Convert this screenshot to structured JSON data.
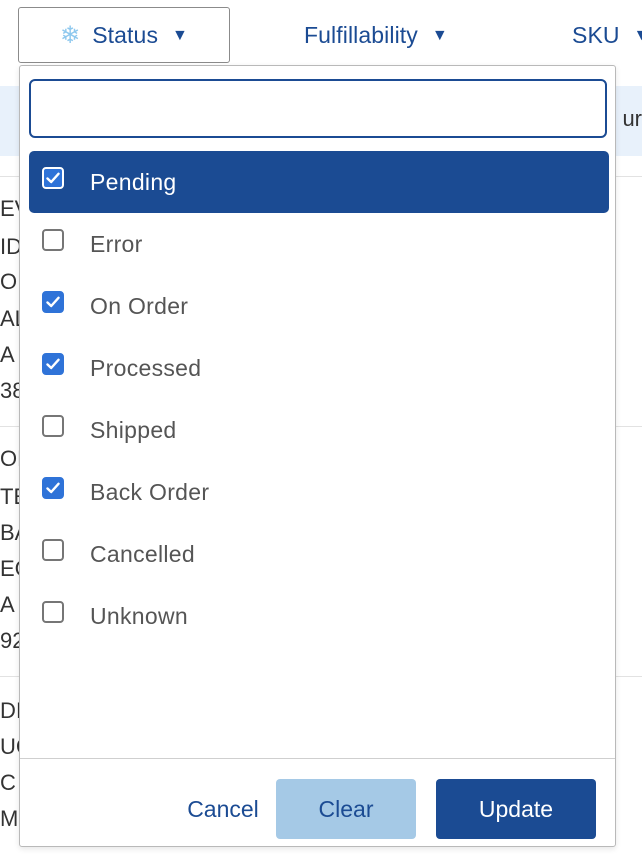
{
  "filters": {
    "status_label": "Status",
    "fulfillability_label": "Fulfillability",
    "sku_label": "SKU"
  },
  "background": {
    "band_text": "ur",
    "fragments": [
      "EV",
      "ID",
      "O",
      "AL",
      "A",
      "38",
      "OK",
      "TE",
      "BA",
      "EG",
      "A",
      "92",
      "DIS",
      "UC",
      "C",
      "MF"
    ]
  },
  "dropdown": {
    "search_value": "",
    "options": [
      {
        "label": "Pending",
        "checked": true
      },
      {
        "label": "Error",
        "checked": false
      },
      {
        "label": "On Order",
        "checked": true
      },
      {
        "label": "Processed",
        "checked": true
      },
      {
        "label": "Shipped",
        "checked": false
      },
      {
        "label": "Back Order",
        "checked": true
      },
      {
        "label": "Cancelled",
        "checked": false
      },
      {
        "label": "Unknown",
        "checked": false
      }
    ],
    "cancel_label": "Cancel",
    "clear_label": "Clear",
    "update_label": "Update"
  },
  "colors": {
    "brand": "#1b4b93",
    "checkbox_checked": "#2f73d8",
    "clear_button": "#a5c9e6",
    "status_icon": "#8ec8ee"
  },
  "icons": {
    "status": "snowflake-icon",
    "caret": "caret-down-icon",
    "checkbox": "check-icon"
  }
}
